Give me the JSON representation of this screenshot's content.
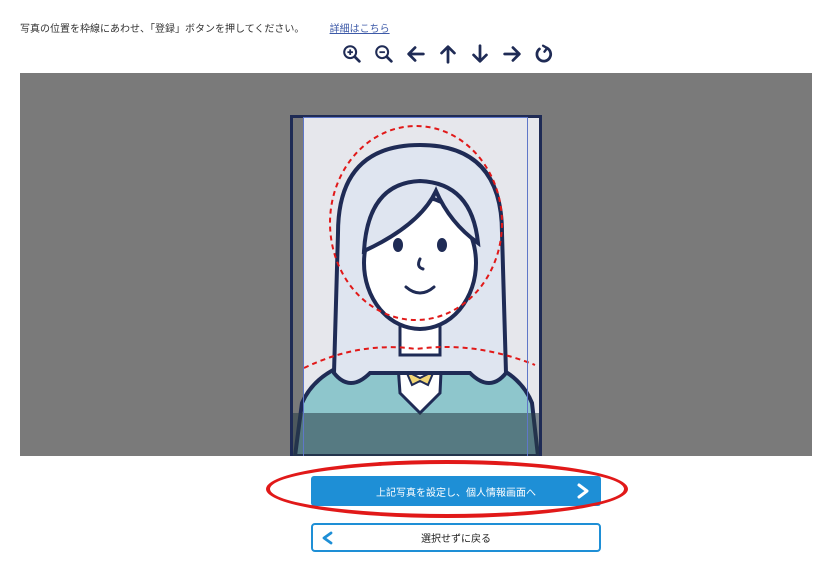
{
  "instruction": {
    "text": "写真の位置を枠線にあわせ、「登録」ボタンを押してください。",
    "link": "詳細はこちら"
  },
  "toolbar": {
    "icons": [
      "zoom-in-icon",
      "zoom-out-icon",
      "arrow-left-icon",
      "arrow-up-icon",
      "arrow-down-icon",
      "arrow-right-icon",
      "rotate-icon"
    ]
  },
  "buttons": {
    "primary_label": "上記写真を設定し、個人情報画面へ",
    "back_label": "選択せずに戻る"
  },
  "colors": {
    "canvas_bg": "#7a7a7a",
    "frame": "#1f2b55",
    "face_guide": "#e11919",
    "primary_button": "#1e8fd6",
    "highlight": "#e11919"
  }
}
